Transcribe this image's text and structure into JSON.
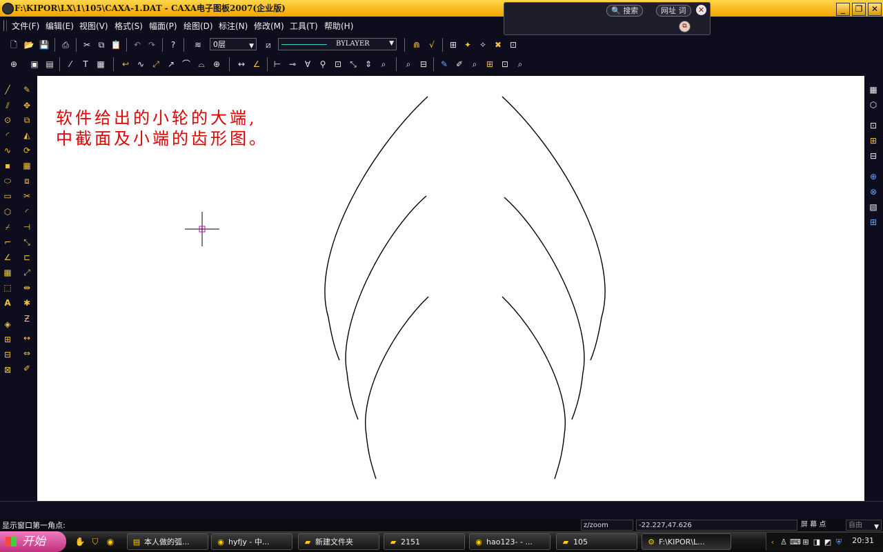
{
  "window": {
    "title": "F:\\KIPOR\\LX\\1\\105\\CAXA-1.DAT - CAXA电子图板2007(企业版)",
    "minimize": "_",
    "restore": "❐",
    "close": "✕"
  },
  "search_widget": {
    "search_label": "搜索",
    "url_label": "网址 词",
    "close": "✕",
    "go": "⧉"
  },
  "menu": {
    "items": [
      "文件(F)",
      "编辑(E)",
      "视图(V)",
      "格式(S)",
      "幅面(P)",
      "绘图(D)",
      "标注(N)",
      "修改(M)",
      "工具(T)",
      "帮助(H)"
    ]
  },
  "toolbar": {
    "layer_value": "0层",
    "linetype_value": "BYLAYER"
  },
  "canvas": {
    "note_line1": "软件给出的小轮的大端,",
    "note_line2": "中截面及小端的齿形图。"
  },
  "command": {
    "prompt": "显示窗口第一角点:"
  },
  "status": {
    "command_name": "z/zoom",
    "coordinates": "-22.227,47.626",
    "snap_label": "屏 幕 点",
    "snap_mode": "自由"
  },
  "taskbar": {
    "start_label": "开始",
    "tasks": [
      {
        "label": "本人做的弧...",
        "icon": "document-icon"
      },
      {
        "label": "hyfjy - 中...",
        "icon": "browser-icon"
      },
      {
        "label": "新建文件夹",
        "icon": "folder-icon"
      },
      {
        "label": "2151",
        "icon": "folder-icon"
      },
      {
        "label": "hao123- - ...",
        "icon": "browser-icon"
      },
      {
        "label": "105",
        "icon": "folder-icon"
      },
      {
        "label": "F:\\KIPOR\\L...",
        "icon": "caxa-icon"
      }
    ],
    "clock": "20:31"
  }
}
